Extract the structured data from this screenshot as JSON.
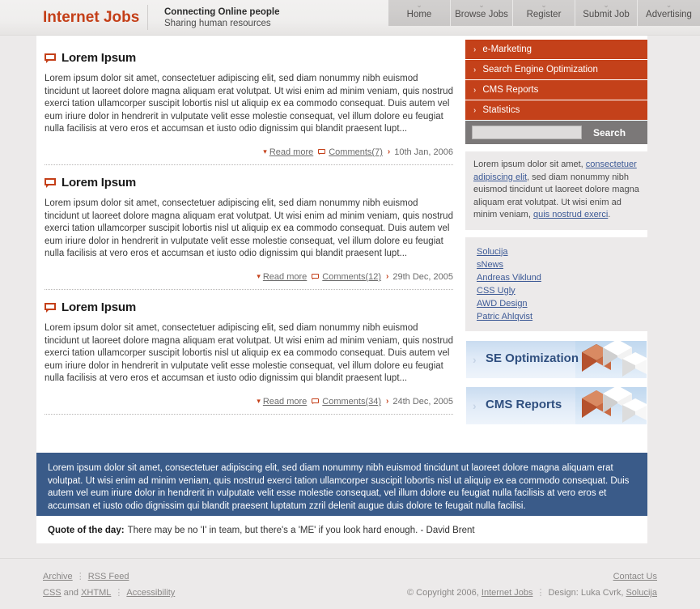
{
  "header": {
    "brand": "Internet Jobs",
    "slogan_line1": "Connecting Online people",
    "slogan_line2": "Sharing human resources",
    "nav": [
      {
        "label": "Home",
        "icon": "chevron-down-icon",
        "caret": "⌄"
      },
      {
        "label": "Browse Jobs",
        "icon": "chevron-down-icon",
        "caret": "⌄"
      },
      {
        "label": "Register",
        "icon": "chevron-down-icon",
        "caret": "⌄"
      },
      {
        "label": "Submit Job",
        "icon": "chevron-down-icon",
        "caret": "⌄"
      },
      {
        "label": "Advertising",
        "icon": "chevron-down-icon",
        "caret": "⌄"
      }
    ]
  },
  "articles": [
    {
      "title": "Lorem Ipsum",
      "body": "Lorem ipsum dolor sit amet, consectetuer adipiscing elit, sed diam nonummy nibh euismod tincidunt ut laoreet dolore magna aliquam erat volutpat. Ut wisi enim ad minim veniam, quis nostrud exerci tation ullamcorper suscipit lobortis nisl ut aliquip ex ea commodo consequat. Duis autem vel eum iriure dolor in hendrerit in vulputate velit esse molestie consequat, vel illum dolore eu feugiat nulla facilisis at vero eros et accumsan et iusto odio dignissim qui blandit praesent lupt...",
      "read_more": "Read more",
      "comments": "Comments(7)",
      "date": "10th Jan, 2006"
    },
    {
      "title": "Lorem Ipsum",
      "body": "Lorem ipsum dolor sit amet, consectetuer adipiscing elit, sed diam nonummy nibh euismod tincidunt ut laoreet dolore magna aliquam erat volutpat. Ut wisi enim ad minim veniam, quis nostrud exerci tation ullamcorper suscipit lobortis nisl ut aliquip ex ea commodo consequat. Duis autem vel eum iriure dolor in hendrerit in vulputate velit esse molestie consequat, vel illum dolore eu feugiat nulla facilisis at vero eros et accumsan et iusto odio dignissim qui blandit praesent lupt...",
      "read_more": "Read more",
      "comments": "Comments(12)",
      "date": "29th Dec, 2005"
    },
    {
      "title": "Lorem Ipsum",
      "body": "Lorem ipsum dolor sit amet, consectetuer adipiscing elit, sed diam nonummy nibh euismod tincidunt ut laoreet dolore magna aliquam erat volutpat. Ut wisi enim ad minim veniam, quis nostrud exerci tation ullamcorper suscipit lobortis nisl ut aliquip ex ea commodo consequat. Duis autem vel eum iriure dolor in hendrerit in vulputate velit esse molestie consequat, vel illum dolore eu feugiat nulla facilisis at vero eros et accumsan et iusto odio dignissim qui blandit praesent lupt...",
      "read_more": "Read more",
      "comments": "Comments(34)",
      "date": "24th Dec, 2005"
    }
  ],
  "sidebar": {
    "menu": [
      {
        "label": "e-Marketing",
        "chevron": "›"
      },
      {
        "label": "Search Engine Optimization",
        "chevron": "›"
      },
      {
        "label": "CMS Reports",
        "chevron": "›"
      },
      {
        "label": "Statistics",
        "chevron": "›"
      }
    ],
    "search": {
      "value": "",
      "placeholder": "",
      "button_label": "Search"
    },
    "about": {
      "part1": "Lorem ipsum dolor sit amet, ",
      "link1": "consectetuer adipiscing elit",
      "part2": ", sed diam nonummy nibh euismod tincidunt ut laoreet dolore magna aliquam erat volutpat. Ut wisi enim ad minim veniam, ",
      "link2": "quis nostrud exerci",
      "part3": "."
    },
    "links": [
      "Solucija",
      "sNews",
      "Andreas Viklund",
      "CSS Ugly",
      "AWD Design",
      "Patric Ahlqvist"
    ],
    "promos": [
      {
        "label": "SE Optimization",
        "chevron": "›"
      },
      {
        "label": "CMS Reports",
        "chevron": "›"
      }
    ]
  },
  "highlight": {
    "text": "Lorem ipsum dolor sit amet, consectetuer adipiscing elit, sed diam nonummy nibh euismod tincidunt ut laoreet dolore magna aliquam erat volutpat. Ut wisi enim ad minim veniam, quis nostrud exerci tation ullamcorper suscipit lobortis nisl ut aliquip ex ea commodo consequat. Duis autem vel eum iriure dolor in hendrerit in vulputate velit esse molestie consequat, vel illum dolore eu feugiat nulla facilisis at vero eros et accumsan et iusto odio dignissim qui blandit praesent luptatum zzril delenit augue duis dolore te feugait nulla facilisi."
  },
  "quote": {
    "label": "Quote of the day:",
    "text": "There may be no 'I' in team, but there's a 'ME' if you look hard enough. - David Brent"
  },
  "footer": {
    "left_row1": [
      "Archive",
      "RSS Feed"
    ],
    "left_row2_a": "CSS",
    "left_row2_and": " and ",
    "left_row2_b": "XHTML",
    "left_row2_c": "Accessibility",
    "contact": "Contact Us",
    "copyright_pre": "© Copyright 2006, ",
    "copyright_link": "Internet Jobs",
    "design_pre": "Design: Luka Cvrk, ",
    "design_link": "Solucija"
  },
  "colors": {
    "accent": "#c4411a",
    "brand": "#c43f18",
    "link": "#3d5a96",
    "highlight_bg": "#3a5b89",
    "search_bar": "#7b7878",
    "page_bg": "#eceaea"
  }
}
